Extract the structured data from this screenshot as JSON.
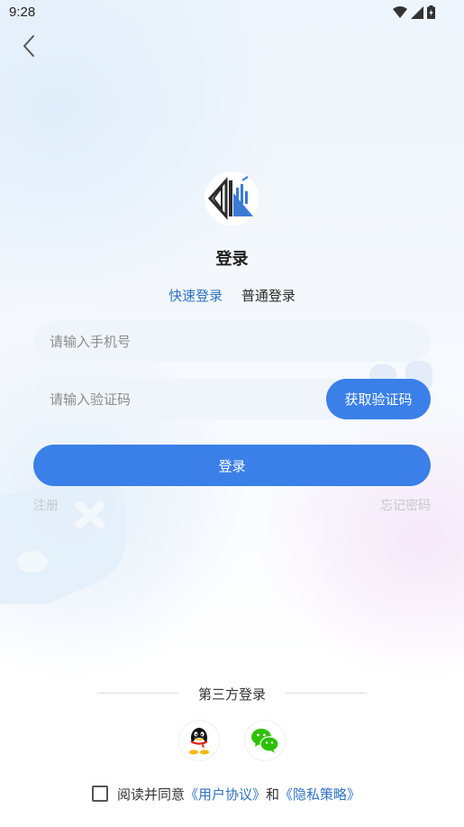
{
  "status_bar": {
    "time": "9:28",
    "icons": [
      "wifi-icon",
      "signal-icon",
      "battery-icon"
    ]
  },
  "page": {
    "title": "登录"
  },
  "tabs": [
    {
      "label": "快速登录",
      "active": true
    },
    {
      "label": "普通登录",
      "active": false
    }
  ],
  "form": {
    "phone_placeholder": "请输入手机号",
    "code_placeholder": "请输入验证码",
    "get_code_label": "获取验证码",
    "login_label": "登录",
    "register_label": "注册",
    "forgot_label": "忘记密码"
  },
  "third_party": {
    "label": "第三方登录",
    "providers": [
      "qq-icon",
      "wechat-icon"
    ]
  },
  "agreement": {
    "prefix": "阅读并同意",
    "user_agreement": "《用户协议》",
    "conjunction": "和",
    "privacy_policy": "《隐私策略》",
    "checked": false
  },
  "colors": {
    "accent": "#3a80e8",
    "link": "#2f72c4",
    "muted": "#c4c9d0"
  }
}
